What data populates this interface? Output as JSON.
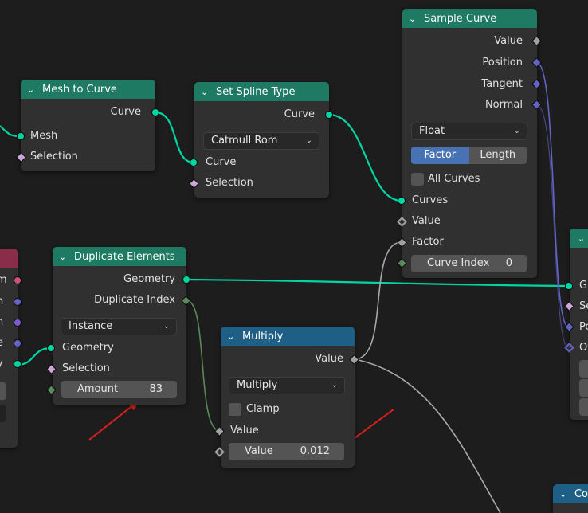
{
  "colors": {
    "geometry_header": "#1e7a62",
    "math_header": "#1e5f85",
    "group_header": "#8a2d4a",
    "geometry_socket": "#00d6a3",
    "vector_socket": "#6363c7",
    "float_socket": "#a1a1a1",
    "annotation_arrow": "#e11e1e",
    "selected_toggle": "#4772b3"
  },
  "mesh_to_curve": {
    "title": "Mesh to Curve",
    "out_curve": "Curve",
    "in_mesh": "Mesh",
    "in_selection": "Selection"
  },
  "set_spline_type": {
    "title": "Set Spline Type",
    "out_curve": "Curve",
    "type": "Catmull Rom",
    "in_curve": "Curve",
    "in_selection": "Selection"
  },
  "sample_curve": {
    "title": "Sample Curve",
    "out_value": "Value",
    "out_position": "Position",
    "out_tangent": "Tangent",
    "out_normal": "Normal",
    "data_type": "Float",
    "mode_factor": "Factor",
    "mode_length": "Length",
    "all_curves": "All Curves",
    "in_curves": "Curves",
    "in_value": "Value",
    "in_factor": "Factor",
    "curve_index_label": "Curve Index",
    "curve_index_value": "0"
  },
  "duplicate_elements": {
    "title": "Duplicate Elements",
    "out_geometry": "Geometry",
    "out_duplicate_index": "Duplicate Index",
    "domain": "Instance",
    "in_geometry": "Geometry",
    "in_selection": "Selection",
    "amount_label": "Amount",
    "amount_value": "83"
  },
  "multiply": {
    "title": "Multiply",
    "out_value": "Value",
    "operation": "Multiply",
    "clamp": "Clamp",
    "in_value": "Value",
    "value_label": "Value",
    "value_value": "0.012"
  },
  "left_partial": {
    "letters": [
      "m",
      "n",
      "n",
      "e",
      "y"
    ]
  },
  "right_partial": {
    "letters": [
      "G",
      "Se",
      "Po",
      "Ot"
    ]
  },
  "bottom_partial": {
    "title_fragment": "Co"
  },
  "icons": {
    "collapse": "chevron-down-icon",
    "dropdown": "dropdown-arrow-icon"
  }
}
